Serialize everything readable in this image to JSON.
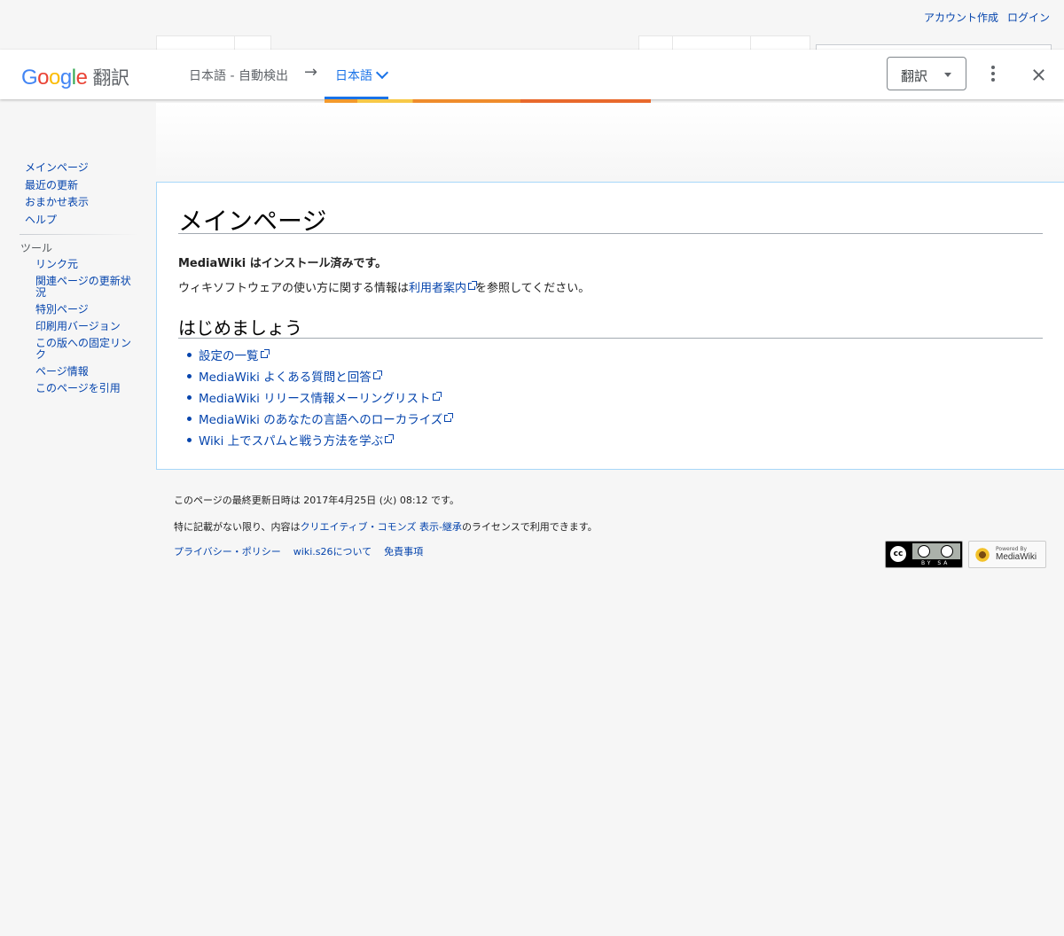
{
  "personal": {
    "create_account": "アカウント作成",
    "login": "ログイン"
  },
  "translate_bar": {
    "logo_word": "Google",
    "logo_suffix": "翻訳",
    "source_lang": "日本語 - 自動検出",
    "arrow": "→",
    "target_lang": "日本語",
    "translate_button": "翻訳",
    "accent_color": "#1a73e8"
  },
  "sidebar": {
    "nav": [
      "メインページ",
      "最近の更新",
      "おまかせ表示",
      "ヘルプ"
    ],
    "tools_heading": "ツール",
    "tools": [
      "リンク元",
      "関連ページの更新状況",
      "特別ページ",
      "印刷用バージョン",
      "この版への固定リンク",
      "ページ情報",
      "このページを引用"
    ]
  },
  "content": {
    "title": "メインページ",
    "installed": "MediaWiki はインストール済みです。",
    "intro_prefix": "ウィキソフトウェアの使い方に関する情報は",
    "intro_link": "利用者案内",
    "intro_suffix": "を参照してください。",
    "section_title": "はじめましょう",
    "links": [
      "設定の一覧",
      "MediaWiki よくある質問と回答",
      "MediaWiki リリース情報メーリングリスト",
      "MediaWiki のあなたの言語へのローカライズ",
      "Wiki 上でスパムと戦う方法を学ぶ"
    ]
  },
  "footer": {
    "last_modified": "このページの最終更新日時は 2017年4月25日 (火) 08:12 です。",
    "license_prefix": "特に記載がない限り、内容は",
    "license_link": "クリエイティブ・コモンズ 表示-継承",
    "license_suffix": "のライセンスで利用できます。",
    "links": [
      "プライバシー・ポリシー",
      "wiki.s26について",
      "免責事項"
    ],
    "cc_badge_text": "cc",
    "cc_by": "BY SA",
    "mw_powered": "Powered By",
    "mw_name": "MediaWiki"
  }
}
